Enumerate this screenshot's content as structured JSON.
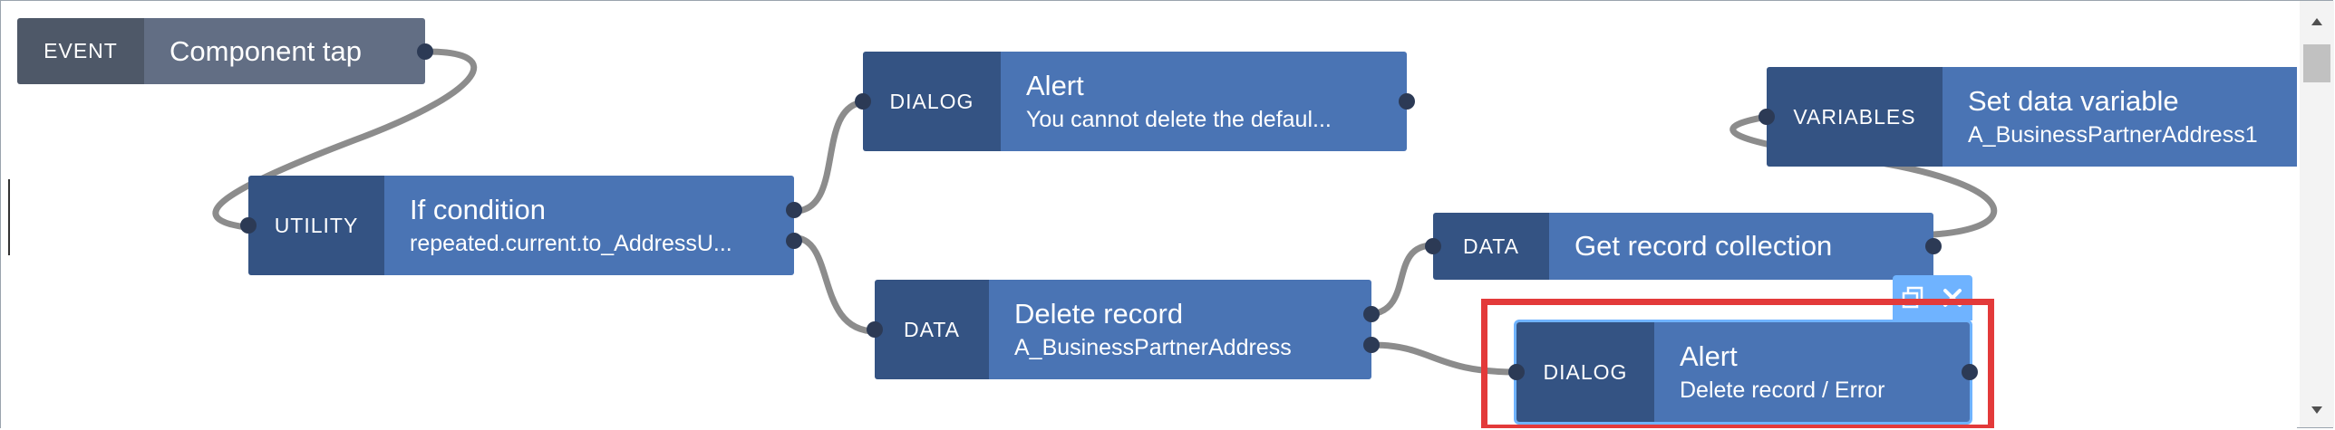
{
  "nodes": {
    "event": {
      "type": "EVENT",
      "title": "Component tap"
    },
    "utility": {
      "type": "UTILITY",
      "title": "If condition",
      "subtitle": "repeated.current.to_AddressU..."
    },
    "dialog1": {
      "type": "DIALOG",
      "title": "Alert",
      "subtitle": "You cannot delete the defaul..."
    },
    "delete": {
      "type": "DATA",
      "title": "Delete record",
      "subtitle": "A_BusinessPartnerAddress"
    },
    "getcoll": {
      "type": "DATA",
      "title": "Get record collection"
    },
    "variables": {
      "type": "VARIABLES",
      "title": "Set data variable",
      "subtitle": "A_BusinessPartnerAddress1"
    },
    "dialog2": {
      "type": "DIALOG",
      "title": "Alert",
      "subtitle": "Delete record / Error"
    }
  },
  "toolbar": {
    "icons": [
      "duplicate-icon",
      "close-icon"
    ]
  },
  "scrollbar": {
    "icons": [
      "arrow-up-icon",
      "arrow-down-icon"
    ]
  },
  "colors": {
    "node_type_blue": "#345383",
    "node_body_blue": "#4a74b4",
    "event_type": "#4e5868",
    "event_body": "#626e84",
    "selection_outline": "#e33a3a",
    "selection_toolbar": "#6fb3ff",
    "wire": "#8c8c8c"
  }
}
